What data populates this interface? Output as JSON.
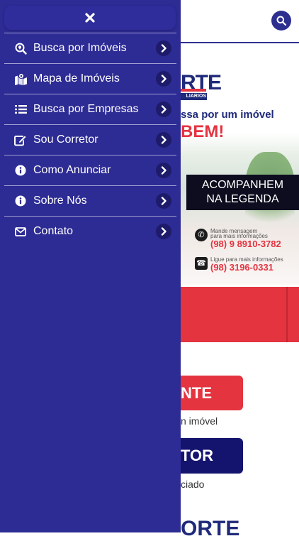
{
  "drawer": {
    "close_icon": "close-icon",
    "items": [
      {
        "label": "Busca por Imóveis",
        "icon": "search-location-icon"
      },
      {
        "label": "Mapa de Imóveis",
        "icon": "map-marker-icon"
      },
      {
        "label": "Busca por Empresas",
        "icon": "list-icon"
      },
      {
        "label": "Sou Corretor",
        "icon": "edit-icon"
      },
      {
        "label": "Como Anunciar",
        "icon": "info-icon"
      },
      {
        "label": "Sobre Nós",
        "icon": "info-icon"
      },
      {
        "label": "Contato",
        "icon": "envelope-icon"
      }
    ]
  },
  "background_page": {
    "logo_text": "RTE",
    "logo_sub": "LIARIOS",
    "tagline": "ssa por um imóvel",
    "tagline_emphasis": "BEM!",
    "legend_box": {
      "line1": "ACOMPANHEM",
      "line2": "NA LEGENDA"
    },
    "whatsapp": {
      "small1": "Mande mensagem",
      "small2": "para mais informações",
      "phone": "(98) 9 8910-3782"
    },
    "landline": {
      "small": "Ligue para mais informações",
      "phone": "(98) 3196-0331"
    },
    "button_red": "NTE",
    "caption_1": "n imóvel",
    "button_navy": "TOR",
    "caption_2": "ciado",
    "bottom_logo": "ORTE"
  },
  "colors": {
    "drawer": "#2d2b94",
    "navy": "#14146f",
    "red": "#e43440",
    "chevron_bg": "#1d1b6a"
  }
}
